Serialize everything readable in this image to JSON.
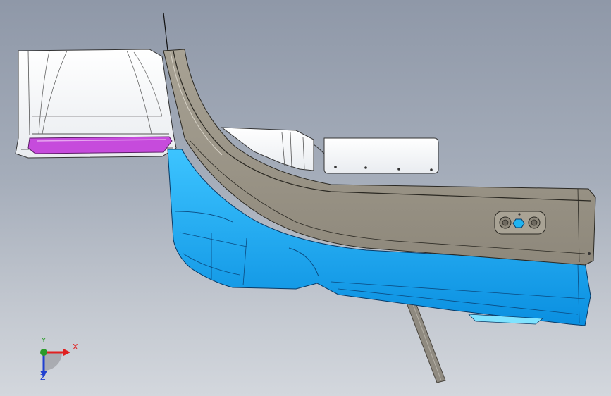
{
  "viewport": {
    "background_top": "#8f98a8",
    "background_bottom": "#d3d7dd"
  },
  "model": {
    "parts": [
      {
        "name": "white-inner-panel",
        "color": "#ffffff"
      },
      {
        "name": "magenta-strip",
        "color": "#c64bdc"
      },
      {
        "name": "gray-trim-panel",
        "color": "#9a9385"
      },
      {
        "name": "blue-outer-panel",
        "color": "#1aa9ee"
      },
      {
        "name": "white-bracket",
        "color": "#ffffff"
      },
      {
        "name": "gray-strut",
        "color": "#8f8a80"
      }
    ],
    "control_panel_icons": [
      "knob-icon",
      "hex-button-icon",
      "knob-icon"
    ]
  },
  "triad": {
    "x_label": "X",
    "y_label": "Y",
    "z_label": "Z",
    "x_color": "#e02020",
    "y_color": "#2a9a2a",
    "z_color": "#2040d0"
  }
}
